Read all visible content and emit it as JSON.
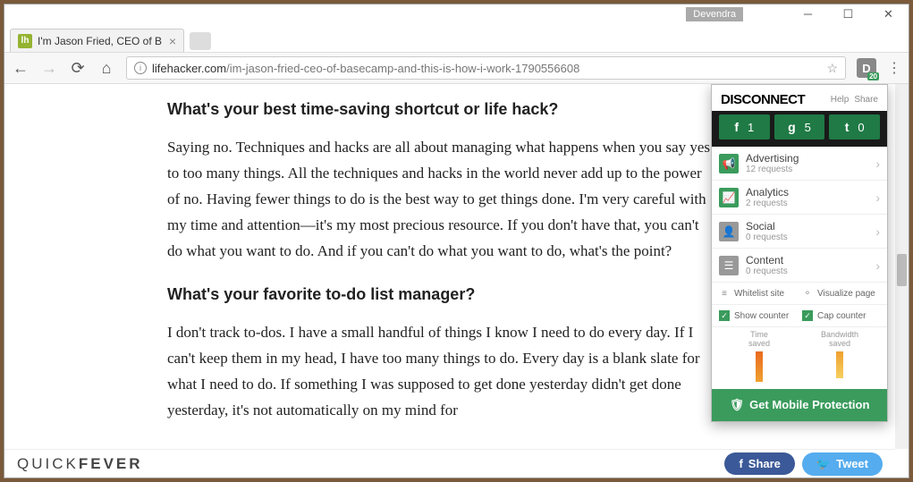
{
  "titlebar": {
    "user": "Devendra"
  },
  "tab": {
    "title": "I'm Jason Fried, CEO of B",
    "favicon_letter": "lh"
  },
  "url": {
    "host": "lifehacker.com",
    "path": "/im-jason-fried-ceo-of-basecamp-and-this-is-how-i-work-1790556608"
  },
  "extension": {
    "letter": "D",
    "badge": "20"
  },
  "article": {
    "h1": "What's your best time-saving shortcut or life hack?",
    "p1": "Saying no. Techniques and hacks are all about managing what happens when you say yes to too many things. All the techniques and hacks in the world never add up to the power of no. Having fewer things to do is the best way to get things done. I'm very careful with my time and attention—it's my most precious resource. If you don't have that, you can't do what you want to do. And if you can't do what you want to do, what's the point?",
    "h2": "What's your favorite to-do list manager?",
    "p2": "I don't track to-dos. I have a small handful of things I know I need to do every day. If I can't keep them in my head, I have too many things to do. Every day is a blank slate for what I need to do. If something I was supposed to get done yesterday didn't get done yesterday, it's not automatically on my mind for"
  },
  "brand": {
    "a": "QUICK",
    "b": "FEVER"
  },
  "share": {
    "fb": "Share",
    "tw": "Tweet"
  },
  "popup": {
    "title": "DISCONNECT",
    "help": "Help",
    "share": "Share",
    "badges": [
      {
        "icon": "f",
        "count": "1"
      },
      {
        "icon": "g",
        "count": "5"
      },
      {
        "icon": "t",
        "count": "0"
      }
    ],
    "cats": [
      {
        "name": "Advertising",
        "req": "12 requests",
        "cls": "green",
        "ic": "📢"
      },
      {
        "name": "Analytics",
        "req": "2 requests",
        "cls": "green",
        "ic": "📈"
      },
      {
        "name": "Social",
        "req": "0 requests",
        "cls": "grey",
        "ic": "👤"
      },
      {
        "name": "Content",
        "req": "0 requests",
        "cls": "grey",
        "ic": "☰"
      }
    ],
    "opt1": "Whitelist site",
    "opt2": "Visualize page",
    "chk1": "Show counter",
    "chk2": "Cap counter",
    "g1": "Time\nsaved",
    "g2": "Bandwidth\nsaved",
    "mobile": "Get Mobile Protection"
  }
}
